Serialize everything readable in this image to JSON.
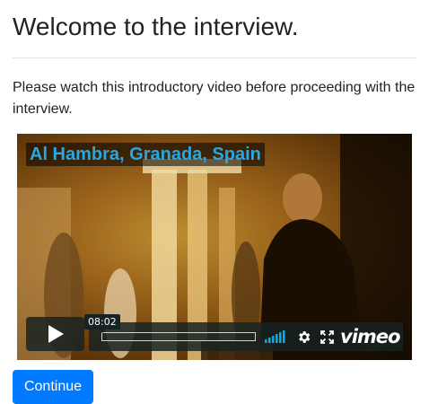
{
  "page": {
    "title": "Welcome to the interview.",
    "intro": "Please watch this introductory video before proceeding with the interview."
  },
  "video": {
    "caption": "Al Hambra, Granada, Spain",
    "duration": "08:02",
    "progress": 0,
    "brand": "vimeo",
    "icons": [
      "play-icon",
      "volume-icon",
      "gear-icon",
      "fullscreen-icon"
    ],
    "accent_color": "#2aa6e0"
  },
  "actions": {
    "continue_label": "Continue",
    "continue_color": "#007bff"
  }
}
